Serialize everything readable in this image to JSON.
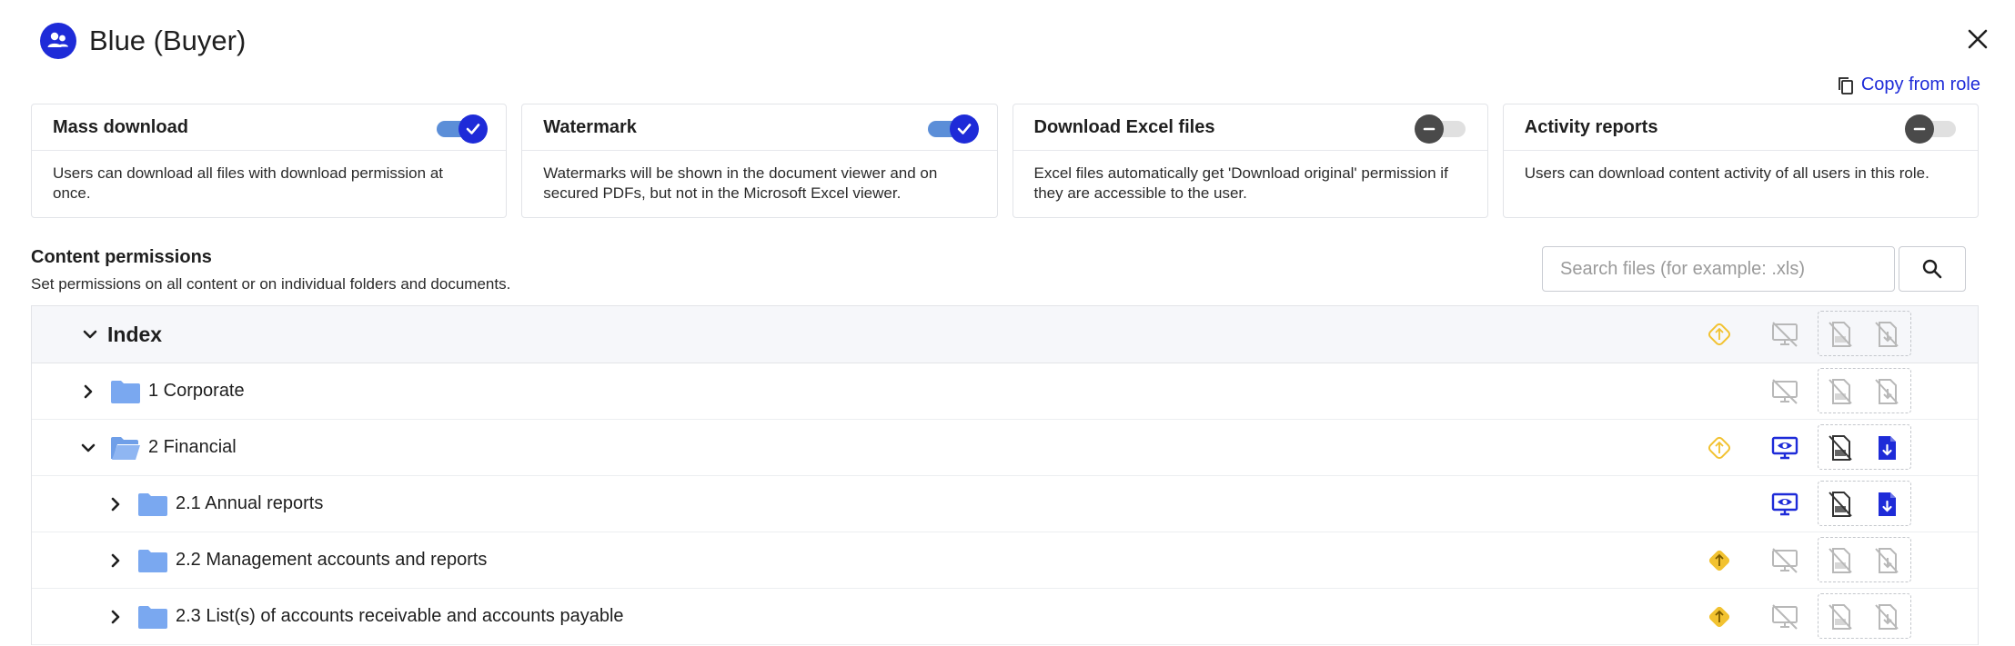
{
  "header": {
    "title": "Blue (Buyer)",
    "icon": "group-icon"
  },
  "actions": {
    "copy_label": "Copy from role",
    "close_icon": "close-icon"
  },
  "cards": [
    {
      "title": "Mass download",
      "enabled": true,
      "description": "Users can download all files with download permission at once."
    },
    {
      "title": "Watermark",
      "enabled": true,
      "description": "Watermarks will be shown in the document viewer and on secured PDFs, but not in the Microsoft Excel viewer."
    },
    {
      "title": "Download Excel files",
      "enabled": false,
      "description": "Excel files automatically get 'Download original' permission if they are accessible to the user."
    },
    {
      "title": "Activity reports",
      "enabled": false,
      "description": "Users can download content activity of all users in this role."
    }
  ],
  "content_permissions": {
    "title": "Content permissions",
    "subtitle": "Set permissions on all content or on individual folders and documents.",
    "search_placeholder": "Search files (for example: .xls)"
  },
  "tree": [
    {
      "label": "Index",
      "expanded": true,
      "level": 0,
      "tag": "outline",
      "view": "off",
      "print": "off",
      "download": "off"
    },
    {
      "label": "1 Corporate",
      "expanded": false,
      "level": 1,
      "tag": "none",
      "view": "off",
      "print": "off",
      "download": "off"
    },
    {
      "label": "2 Financial",
      "expanded": true,
      "level": 1,
      "tag": "outline",
      "view": "on",
      "print": "dark",
      "download": "on"
    },
    {
      "label": "2.1 Annual reports",
      "expanded": false,
      "level": 2,
      "tag": "none",
      "view": "on",
      "print": "dark",
      "download": "on"
    },
    {
      "label": "2.2 Management accounts and reports",
      "expanded": false,
      "level": 2,
      "tag": "filled",
      "view": "off",
      "print": "off",
      "download": "off"
    },
    {
      "label": "2.3 List(s) of accounts receivable and accounts payable",
      "expanded": false,
      "level": 2,
      "tag": "filled",
      "view": "off",
      "print": "off",
      "download": "off"
    }
  ],
  "colors": {
    "accent": "#1e2bd8",
    "toggle_track_on": "#5b8ed8",
    "folder": "#7aa8f0",
    "tag": "#f2c230",
    "disabled_icon": "#b8b8b8"
  }
}
